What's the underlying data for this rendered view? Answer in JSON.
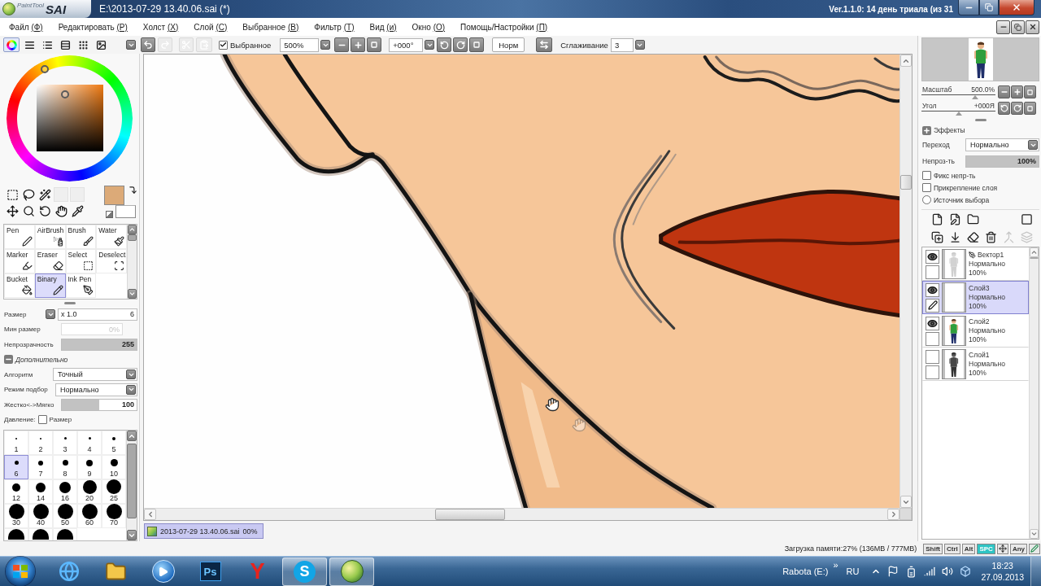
{
  "window": {
    "logo_small": "PaintTool",
    "logo_large": "SAI",
    "title": "E:\\2013-07-29 13.40.06.sai (*)",
    "version": "Ver.1.1.0: 14 день триала (из 31"
  },
  "menu": [
    {
      "label": "Файл",
      "hotkey": "(Ф)"
    },
    {
      "label": "Редактировать",
      "hotkey": "(Р)"
    },
    {
      "label": "Холст",
      "hotkey": "(Х)"
    },
    {
      "label": "Слой",
      "hotkey": "(С)"
    },
    {
      "label": "Выбранное",
      "hotkey": "(В)"
    },
    {
      "label": "Фильтр",
      "hotkey": "(Т)"
    },
    {
      "label": "Вид",
      "hotkey": "(и)"
    },
    {
      "label": "Окно",
      "hotkey": "(О)"
    },
    {
      "label": "Помощь/Настройки",
      "hotkey": "(П)"
    }
  ],
  "palette_views": [
    {
      "selected": true
    },
    {
      "selected": false
    },
    {
      "selected": false
    },
    {
      "selected": false
    },
    {
      "selected": false
    },
    {
      "selected": false
    }
  ],
  "edit_buttons": [
    {
      "disabled": false
    },
    {
      "disabled": true
    },
    {
      "disabled": true
    },
    {
      "disabled": true
    }
  ],
  "toolbar": {
    "selection": {
      "label": "Выбранное",
      "checked": true
    },
    "zoom": "500%",
    "angle": "+000°",
    "reset_button": "Норм",
    "smoothing_label": "Сглаживание",
    "smoothing": "3"
  },
  "tools": [
    {
      "label": "Pen",
      "selected": false
    },
    {
      "label": "AirBrush",
      "selected": false
    },
    {
      "label": "Brush",
      "selected": false
    },
    {
      "label": "Water",
      "selected": false
    },
    {
      "label": "Marker",
      "selected": false
    },
    {
      "label": "Eraser",
      "selected": false
    },
    {
      "label": "Select",
      "selected": false
    },
    {
      "label": "Deselect",
      "selected": false
    },
    {
      "label": "Bucket",
      "selected": false
    },
    {
      "label": "Binary",
      "selected": true
    },
    {
      "label": "Ink Pen",
      "selected": false
    }
  ],
  "brush": {
    "size": {
      "label": "Размер",
      "scale": "x 1.0",
      "value": "6"
    },
    "min_size": {
      "label": "Мин размер",
      "value": "0%",
      "disabled": true
    },
    "opacity": {
      "label": "Непрозрачность",
      "value": "255",
      "level": 1
    },
    "advanced": {
      "label": "Дополнительно",
      "expanded": true
    },
    "algorithm": {
      "label": "Алгоритм",
      "value": "Точный"
    },
    "mode": {
      "label": "Режим подбор",
      "value": "Нормально"
    },
    "hardness": {
      "label": "Жестко<->Мягко",
      "value": "100",
      "level": 0.5
    },
    "pressure": {
      "label": "Давление:",
      "option": "Размер",
      "checked": false
    }
  },
  "brush_sizes": [
    {
      "label": "1",
      "selected": false
    },
    {
      "label": "2",
      "selected": false
    },
    {
      "label": "3",
      "selected": false
    },
    {
      "label": "4",
      "selected": false
    },
    {
      "label": "5",
      "selected": false
    },
    {
      "label": "6",
      "selected": true
    },
    {
      "label": "7",
      "selected": false
    },
    {
      "label": "8",
      "selected": false
    },
    {
      "label": "9",
      "selected": false
    },
    {
      "label": "10",
      "selected": false
    },
    {
      "label": "12",
      "selected": false
    },
    {
      "label": "14",
      "selected": false
    },
    {
      "label": "16",
      "selected": false
    },
    {
      "label": "20",
      "selected": false
    },
    {
      "label": "25",
      "selected": false
    },
    {
      "label": "30",
      "selected": false
    },
    {
      "label": "40",
      "selected": false
    },
    {
      "label": "50",
      "selected": false
    },
    {
      "label": "60",
      "selected": false
    },
    {
      "label": "70",
      "selected": false
    },
    {
      "selected": false
    },
    {
      "selected": false
    },
    {
      "selected": false
    }
  ],
  "document_tabs": [
    {
      "name": "2013-07-29 13.40.06.sai",
      "zoom": "00%",
      "selected": true
    }
  ],
  "navigator": {
    "zoom": {
      "label": "Масштаб",
      "value": "500.0%",
      "level": 0.73
    },
    "angle": {
      "label": "Угол",
      "value": "+000Я",
      "level": 0.5
    }
  },
  "layer_settings": {
    "effects": {
      "label": "Эффекты",
      "expanded": false
    },
    "blend": {
      "label": "Переход",
      "value": "Нормально"
    },
    "opacity": {
      "label": "Непроз-ть",
      "value": "100%",
      "level": 1
    },
    "options": [
      {
        "kind": "checkbox",
        "label": "Фикс непр-ть",
        "checked": false
      },
      {
        "kind": "checkbox",
        "label": "Прикрепление слоя",
        "checked": false
      },
      {
        "kind": "radio",
        "label": "Источник выбора",
        "checked": false
      }
    ]
  },
  "layer_tools": [
    {
      "disabled": false
    },
    {
      "disabled": false
    },
    {
      "disabled": false
    },
    {
      "disabled": false
    },
    {
      "disabled": false
    },
    {
      "disabled": false
    },
    {
      "disabled": false
    },
    {
      "disabled": false
    },
    {
      "disabled": true
    },
    {
      "disabled": true
    }
  ],
  "layers": [
    {
      "name": "Вектор1",
      "kind": "vector",
      "blend": "Нормально",
      "opacity": "100%",
      "visible": true,
      "selected": false
    },
    {
      "name": "Слой3",
      "kind": "raster",
      "blend": "Нормально",
      "opacity": "100%",
      "visible": true,
      "selected": true
    },
    {
      "name": "Слой2",
      "kind": "raster",
      "blend": "Нормально",
      "opacity": "100%",
      "visible": true,
      "selected": false
    },
    {
      "name": "Слой1",
      "kind": "raster",
      "blend": "Нормально",
      "opacity": "100%",
      "visible": false,
      "selected": false
    }
  ],
  "status_bar": {
    "memory": "Загрузка памяти:27% (136MB / 777MB)",
    "keys": [
      {
        "label": "Shift",
        "on": false
      },
      {
        "label": "Ctrl",
        "on": false
      },
      {
        "label": "Alt",
        "on": false
      },
      {
        "label": "SPC",
        "on": true
      }
    ],
    "mode": "Any"
  },
  "taskbar": {
    "apps": [
      {
        "kind": "browser",
        "active": false
      },
      {
        "kind": "folder",
        "active": false
      },
      {
        "kind": "player",
        "active": false
      },
      {
        "kind": "photoshop",
        "glyph": "Ps",
        "active": false
      },
      {
        "kind": "yandex",
        "glyph": "Y",
        "active": false
      },
      {
        "kind": "skype",
        "glyph": "S",
        "active": true
      },
      {
        "kind": "sai",
        "active": true
      }
    ],
    "drive": "Rabota (E:)",
    "overflow": "»",
    "language": "RU",
    "time": "18:23",
    "date": "27.09.2013"
  }
}
